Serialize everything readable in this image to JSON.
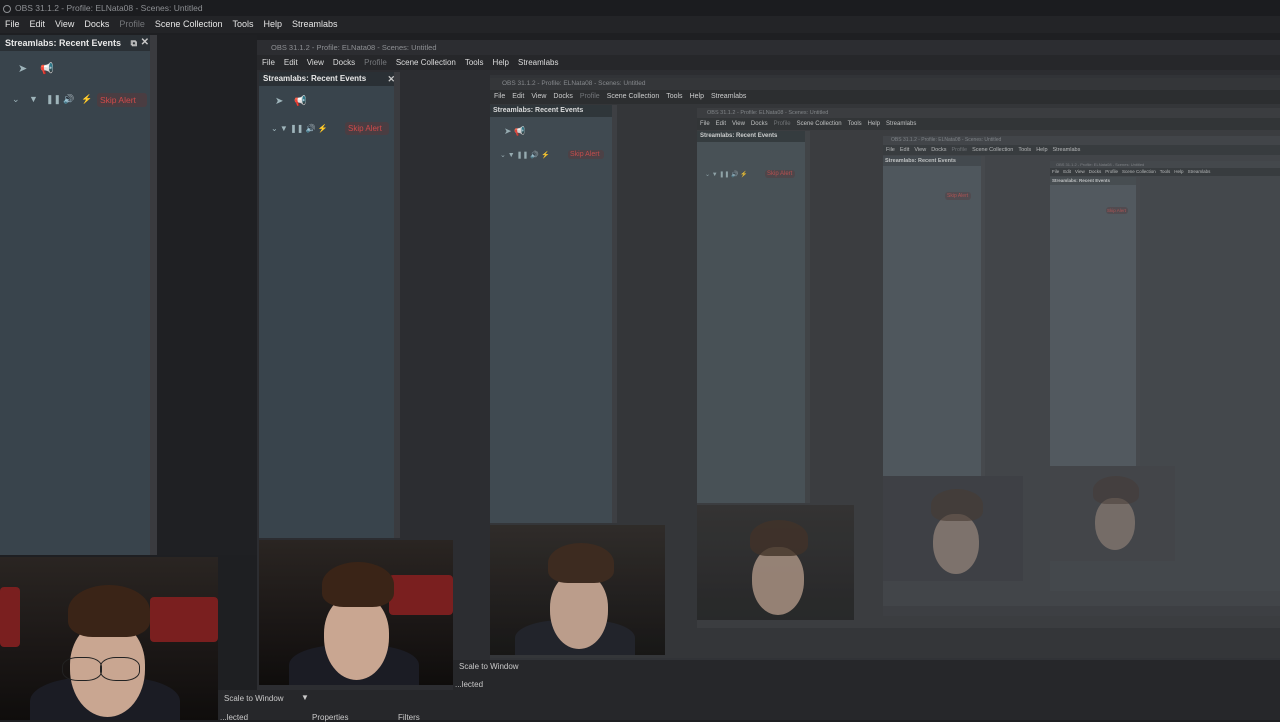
{
  "window": {
    "title": "OBS 31.1.2 - Profile: ELNata08 - Scenes: Untitled"
  },
  "menu": {
    "file": "File",
    "edit": "Edit",
    "view": "View",
    "docks": "Docks",
    "profile": "Profile",
    "scene_collection": "Scene Collection",
    "tools": "Tools",
    "help": "Help",
    "streamlabs": "Streamlabs"
  },
  "dock": {
    "title": "Streamlabs: Recent Events",
    "skip_label": "Skip Alert",
    "icons": [
      "plane-icon",
      "megaphone-icon",
      "chevron-down-icon",
      "filter-icon",
      "pause-icon",
      "volume-icon",
      "flash-icon"
    ]
  },
  "preview": {
    "scale_label": "Scale to Window",
    "status_label": "...lected",
    "properties_label": "Properties",
    "filters_label": "Filters"
  },
  "colors": {
    "dock_bg": "#39444c",
    "skip_red": "#d04a4a"
  }
}
